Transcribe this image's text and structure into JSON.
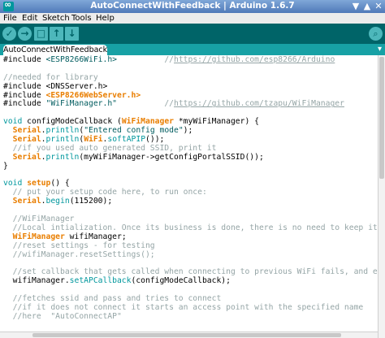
{
  "window": {
    "title": "AutoConnectWithFeedback | Arduino 1.6.7",
    "controls": [
      "▼",
      "▲",
      "✕"
    ]
  },
  "menu": [
    "File",
    "Edit",
    "Sketch",
    "Tools",
    "Help"
  ],
  "toolbar": {
    "verify_glyph": "✓",
    "upload_glyph": "→",
    "new_glyph": "□",
    "open_glyph": "↑",
    "save_glyph": "↓",
    "serial_glyph": "⌕"
  },
  "tab": {
    "label": "AutoConnectWithFeedback",
    "menu_glyph": "▾"
  },
  "colors": {
    "toolbar": "#006468",
    "tabbar": "#17a1a5",
    "keyword": "#728e00",
    "class_type": "#e97e00",
    "function": "#00979d",
    "string": "#005c5f",
    "comment": "#95a5a6"
  },
  "code_lines": [
    [
      {
        "t": "#include ",
        "c": "plain"
      },
      {
        "t": "<ESP8266WiFi.h>",
        "c": "str"
      },
      {
        "t": "          //",
        "c": "cm"
      },
      {
        "t": "https://github.com/esp8266/Arduino",
        "c": "url"
      }
    ],
    [],
    [
      {
        "t": "//needed for library",
        "c": "cm"
      }
    ],
    [
      {
        "t": "#include ",
        "c": "plain"
      },
      {
        "t": "<DNSServer.h>",
        "c": "plain"
      }
    ],
    [
      {
        "t": "#include ",
        "c": "plain"
      },
      {
        "t": "<ESP8266WebServer.h>",
        "c": "kw2"
      }
    ],
    [
      {
        "t": "#include ",
        "c": "plain"
      },
      {
        "t": "\"WiFiManager.h\"",
        "c": "str"
      },
      {
        "t": "          //",
        "c": "cm"
      },
      {
        "t": "https://github.com/tzapu/WiFiManager",
        "c": "url"
      }
    ],
    [],
    [
      {
        "t": "void",
        "c": "kw3"
      },
      {
        "t": " configModeCallback (",
        "c": "plain"
      },
      {
        "t": "WiFiManager",
        "c": "kw2"
      },
      {
        "t": " *myWiFiManager) {",
        "c": "plain"
      }
    ],
    [
      {
        "t": "  ",
        "c": "plain"
      },
      {
        "t": "Serial",
        "c": "kw2"
      },
      {
        "t": ".",
        "c": "plain"
      },
      {
        "t": "println",
        "c": "kw3"
      },
      {
        "t": "(",
        "c": "plain"
      },
      {
        "t": "\"Entered config mode\"",
        "c": "str"
      },
      {
        "t": ");",
        "c": "plain"
      }
    ],
    [
      {
        "t": "  ",
        "c": "plain"
      },
      {
        "t": "Serial",
        "c": "kw2"
      },
      {
        "t": ".",
        "c": "plain"
      },
      {
        "t": "println",
        "c": "kw3"
      },
      {
        "t": "(",
        "c": "plain"
      },
      {
        "t": "WiFi",
        "c": "kw2"
      },
      {
        "t": ".",
        "c": "plain"
      },
      {
        "t": "softAPIP",
        "c": "kw3"
      },
      {
        "t": "());",
        "c": "plain"
      }
    ],
    [
      {
        "t": "  //if you used auto generated SSID, print it",
        "c": "cm"
      }
    ],
    [
      {
        "t": "  ",
        "c": "plain"
      },
      {
        "t": "Serial",
        "c": "kw2"
      },
      {
        "t": ".",
        "c": "plain"
      },
      {
        "t": "println",
        "c": "kw3"
      },
      {
        "t": "(myWiFiManager->getConfigPortalSSID());",
        "c": "plain"
      }
    ],
    [
      {
        "t": "}",
        "c": "plain"
      }
    ],
    [],
    [
      {
        "t": "void",
        "c": "kw3"
      },
      {
        "t": " ",
        "c": "plain"
      },
      {
        "t": "setup",
        "c": "kw2"
      },
      {
        "t": "() {",
        "c": "plain"
      }
    ],
    [
      {
        "t": "  // put your setup code here, to run once:",
        "c": "cm"
      }
    ],
    [
      {
        "t": "  ",
        "c": "plain"
      },
      {
        "t": "Serial",
        "c": "kw2"
      },
      {
        "t": ".",
        "c": "plain"
      },
      {
        "t": "begin",
        "c": "kw3"
      },
      {
        "t": "(115200);",
        "c": "plain"
      }
    ],
    [],
    [
      {
        "t": "  //WiFiManager",
        "c": "cm"
      }
    ],
    [
      {
        "t": "  //Local intialization. Once its business is done, there is no need to keep it around",
        "c": "cm"
      }
    ],
    [
      {
        "t": "  ",
        "c": "plain"
      },
      {
        "t": "WiFiManager",
        "c": "kw2"
      },
      {
        "t": " wifiManager;",
        "c": "plain"
      }
    ],
    [
      {
        "t": "  //reset settings - for testing",
        "c": "cm"
      }
    ],
    [
      {
        "t": "  //wifiManager.resetSettings();",
        "c": "cm"
      }
    ],
    [],
    [
      {
        "t": "  //set callback that gets called when connecting to previous WiFi fails, and enters Access",
        "c": "cm"
      }
    ],
    [
      {
        "t": "  wifiManager.",
        "c": "plain"
      },
      {
        "t": "setAPCallback",
        "c": "kw3"
      },
      {
        "t": "(configModeCallback);",
        "c": "plain"
      }
    ],
    [],
    [
      {
        "t": "  //fetches ssid and pass and tries to connect",
        "c": "cm"
      }
    ],
    [
      {
        "t": "  //if it does not connect it starts an access point with the specified name",
        "c": "cm"
      }
    ],
    [
      {
        "t": "  //here  \"AutoConnectAP\"",
        "c": "cm"
      }
    ]
  ]
}
